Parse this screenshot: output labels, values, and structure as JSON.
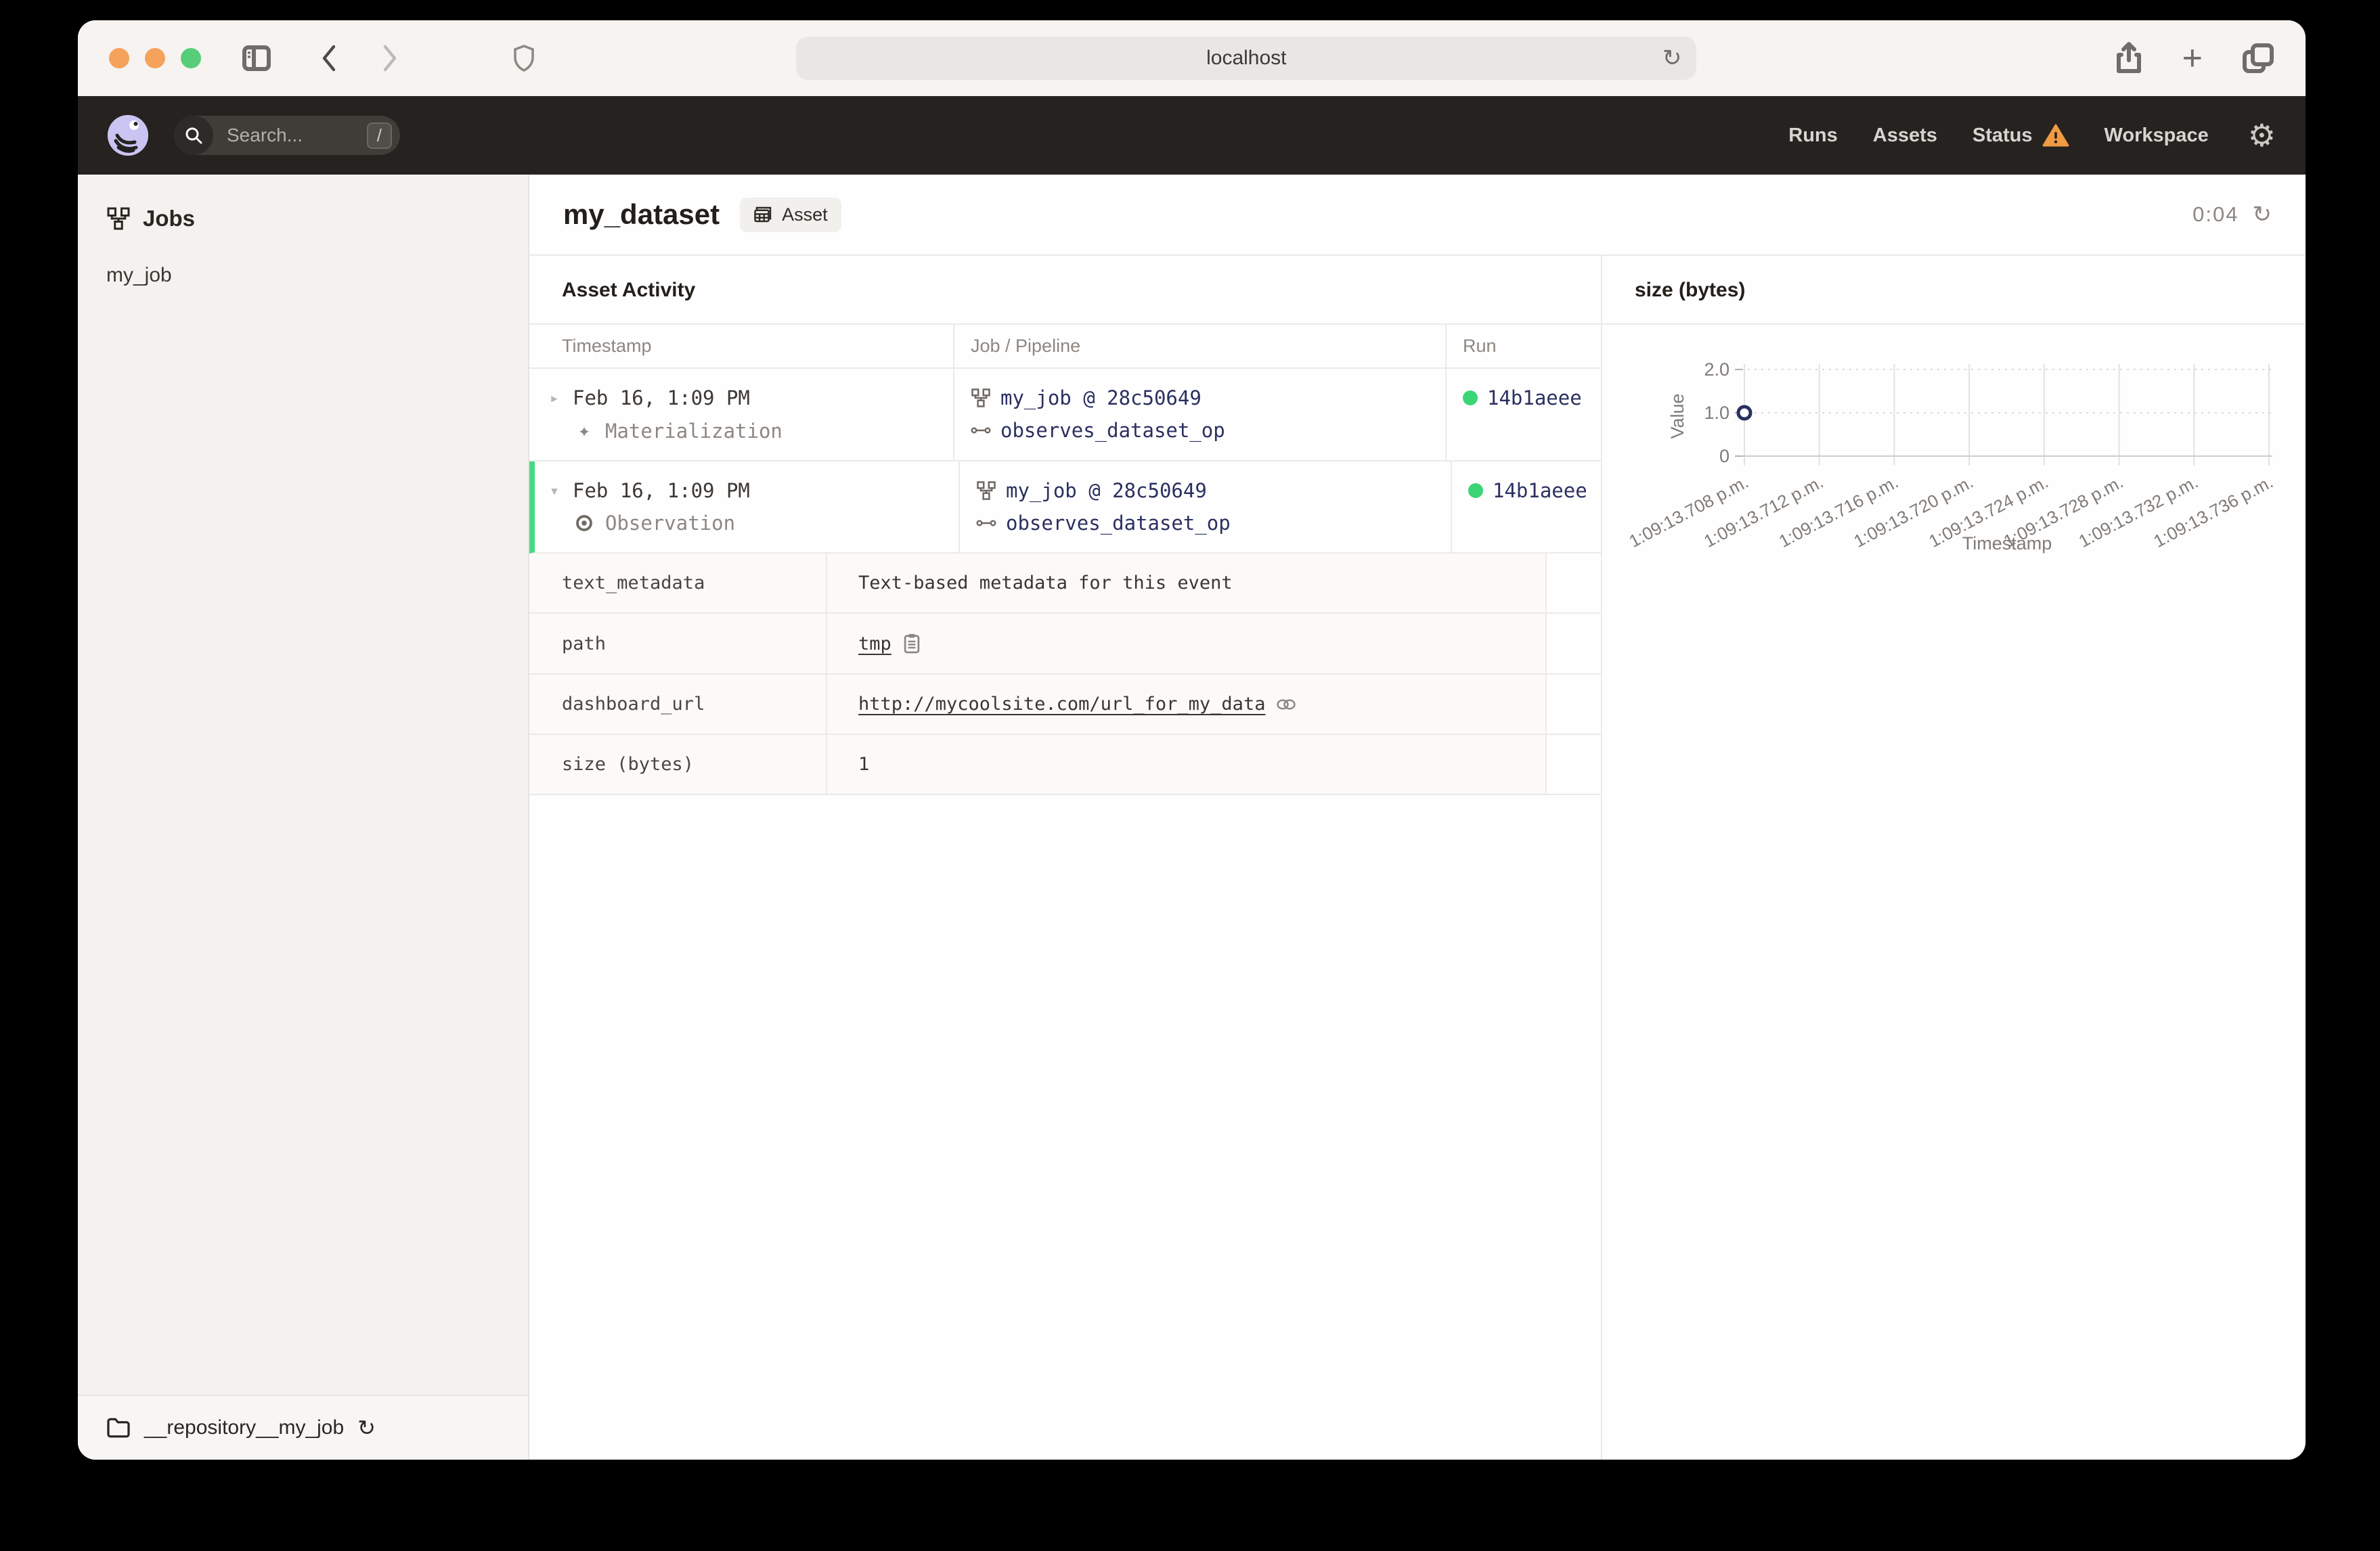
{
  "browser": {
    "url": "localhost"
  },
  "navbar": {
    "search_placeholder": "Search...",
    "search_shortcut": "/",
    "links": {
      "runs": "Runs",
      "assets": "Assets",
      "status": "Status",
      "workspace": "Workspace"
    }
  },
  "sidebar": {
    "title": "Jobs",
    "items": [
      {
        "label": "my_job"
      }
    ],
    "repository": "__repository__my_job"
  },
  "header": {
    "title": "my_dataset",
    "tag": "Asset",
    "timer": "0:04"
  },
  "activity": {
    "heading": "Asset Activity",
    "columns": [
      "Timestamp",
      "Job / Pipeline",
      "Run"
    ],
    "rows": [
      {
        "timestamp": "Feb 16, 1:09 PM",
        "event_type": "Materialization",
        "job": "my_job @ 28c50649",
        "op": "observes_dataset_op",
        "run_id": "14b1aeee"
      },
      {
        "timestamp": "Feb 16, 1:09 PM",
        "event_type": "Observation",
        "job": "my_job @ 28c50649",
        "op": "observes_dataset_op",
        "run_id": "14b1aeee"
      }
    ],
    "metadata": [
      {
        "key": "text_metadata",
        "value": "Text-based metadata for this event"
      },
      {
        "key": "path",
        "value": "tmp"
      },
      {
        "key": "dashboard_url",
        "value": "http://mycoolsite.com/url_for_my_data"
      },
      {
        "key": "size (bytes)",
        "value": "1"
      }
    ]
  },
  "chart_data": {
    "type": "scatter",
    "title": "size (bytes)",
    "xlabel": "Timestamp",
    "ylabel": "Value",
    "ylim": [
      0,
      2
    ],
    "yticks": [
      "0",
      "1.0",
      "2.0"
    ],
    "grid": true,
    "legend": false,
    "x": [
      "1:09:13.708 p.m.",
      "1:09:13.712 p.m.",
      "1:09:13.716 p.m.",
      "1:09:13.720 p.m.",
      "1:09:13.724 p.m.",
      "1:09:13.728 p.m.",
      "1:09:13.732 p.m.",
      "1:09:13.736 p.m."
    ],
    "points": [
      {
        "x": "1:09:13.708 p.m.",
        "y": 1
      }
    ]
  },
  "glyphs": {
    "reload": "↻",
    "gear": "⚙",
    "plus": "+",
    "caret_collapsed": "▸",
    "caret_expanded": "▾",
    "materialization_star": "✦"
  },
  "colors": {
    "traffic_close": "#f5a25b",
    "traffic_min": "#f5a25b",
    "traffic_max": "#57cd7a",
    "navbar_bg": "#262220",
    "logo": "#cac4f3",
    "warning": "#f09a42",
    "success_green": "#3bd476",
    "row_accent_green": "#44da82",
    "link_navy": "#2a3060"
  }
}
